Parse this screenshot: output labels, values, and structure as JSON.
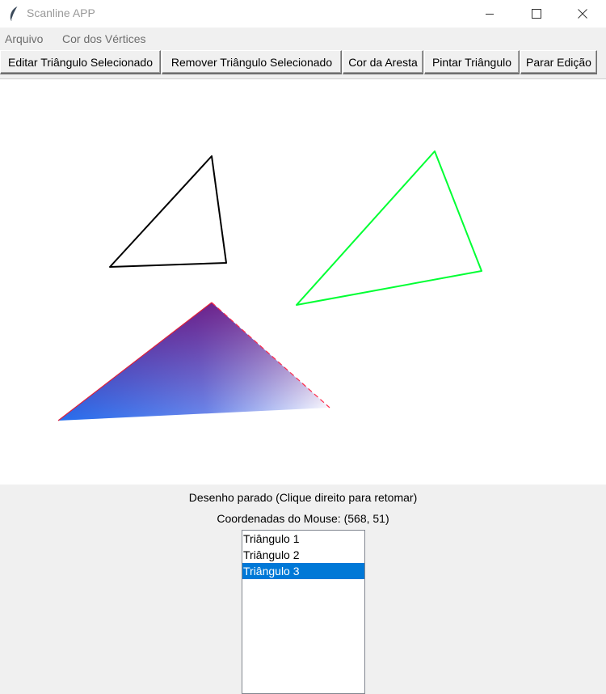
{
  "window": {
    "title": "Scanline APP",
    "icon": "feather-icon"
  },
  "menu": {
    "items": [
      "Arquivo",
      "Cor dos Vértices"
    ]
  },
  "toolbar": {
    "buttons": [
      "Editar Triângulo Selecionado",
      "Remover Triângulo Selecionado",
      "Cor da Aresta",
      "Pintar Triângulo",
      "Parar Edição"
    ]
  },
  "canvas": {
    "colors": {
      "black_outline": "#000000",
      "green_outline": "#00ff33",
      "edge_red": "#ff0000",
      "gradient_top": "#6a0e7a",
      "gradient_left": "#1a7cff",
      "gradient_right": "#ffffff"
    }
  },
  "status": {
    "drawing": "Desenho parado (Clique direito para retomar)",
    "mouse": "Coordenadas do Mouse: (568, 51)"
  },
  "list": {
    "items": [
      "Triângulo 1",
      "Triângulo 2",
      "Triângulo 3"
    ],
    "selected_index": 2
  },
  "accent": "#0078d7"
}
